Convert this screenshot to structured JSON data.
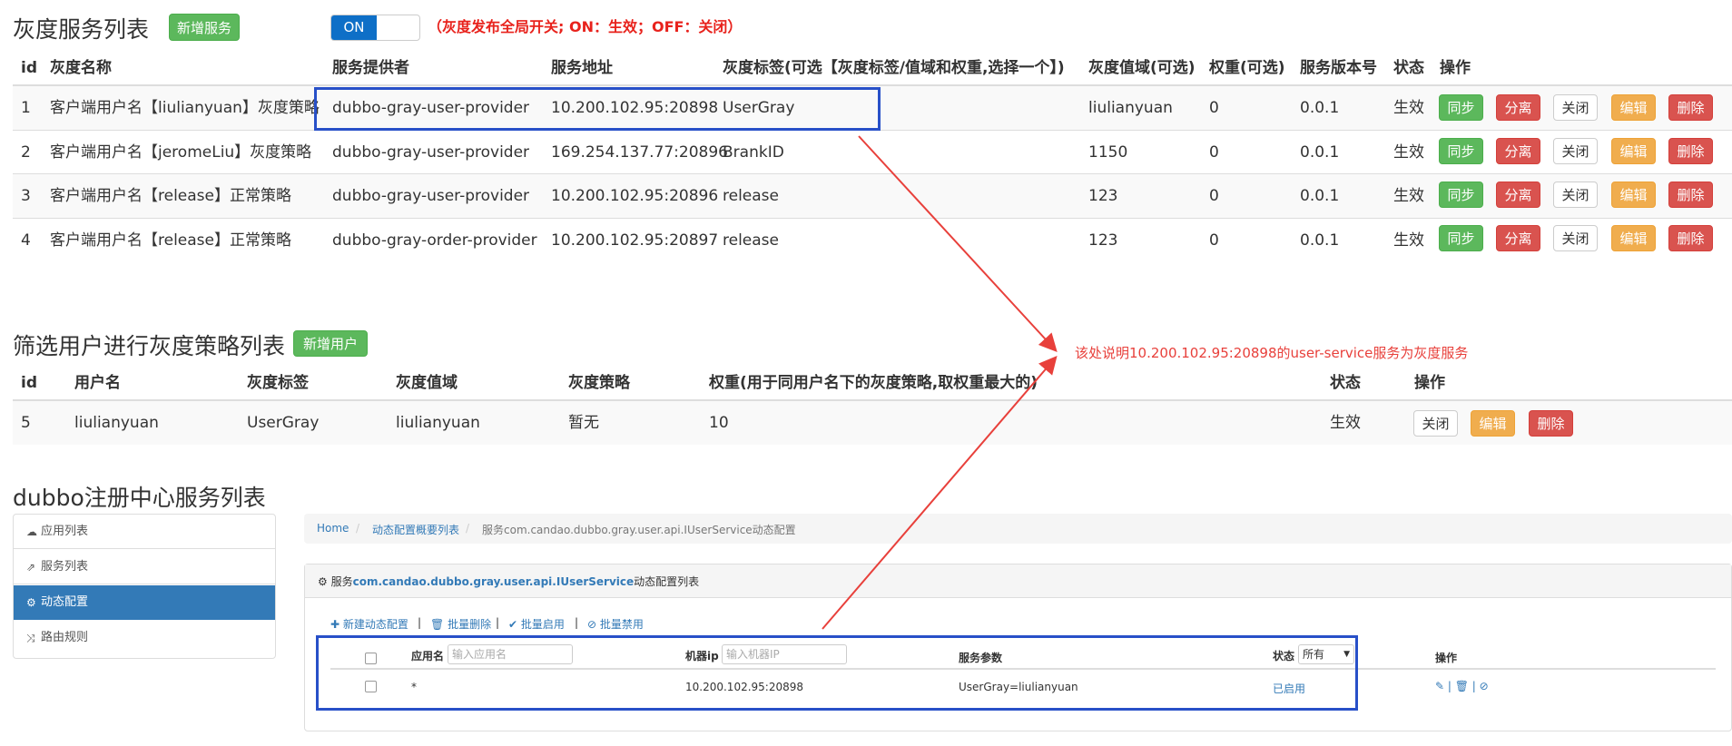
{
  "gray_section": {
    "title": "灰度服务列表",
    "add_button": "新增服务",
    "switch_on_label": "ON",
    "switch_note": "（灰度发布全局开关; ON：生效；OFF：关闭）",
    "columns": [
      "id",
      "灰度名称",
      "服务提供者",
      "服务地址",
      "灰度标签(可选【灰度标签/值域和权重,选择一个】)",
      "灰度值域(可选)",
      "权重(可选)",
      "服务版本号",
      "状态",
      "操作"
    ],
    "rows": [
      {
        "id": "1",
        "name": "客户端用户名【liuliany​uan】灰度策略",
        "provider": "dubbo-gray-user-provider",
        "address": "10.200.102.95:20898",
        "tag": "UserGray",
        "range": "liulianyuan",
        "weight": "0",
        "version": "0.0.1",
        "status": "生效"
      },
      {
        "id": "2",
        "name": "客户端用户名【jeromeLiu】灰度策略",
        "provider": "dubbo-gray-user-provider",
        "address": "169.254.137.77:20896",
        "tag": "BrankID",
        "range": "1150",
        "weight": "0",
        "version": "0.0.1",
        "status": "生效"
      },
      {
        "id": "3",
        "name": "客户端用户名【release】正常策略",
        "provider": "dubbo-gray-user-provider",
        "address": "10.200.102.95:20896",
        "tag": "release",
        "range": "123",
        "weight": "0",
        "version": "0.0.1",
        "status": "生效"
      },
      {
        "id": "4",
        "name": "客户端用户名【release】正常策略",
        "provider": "dubbo-gray-order-provider",
        "address": "10.200.102.95:20897",
        "tag": "release",
        "range": "123",
        "weight": "0",
        "version": "0.0.1",
        "status": "生效"
      }
    ],
    "actions": {
      "sync": "同步",
      "separate": "分离",
      "close": "关闭",
      "edit": "编辑",
      "delete": "删除"
    }
  },
  "user_section": {
    "title": "筛选用户进行灰度策略列表",
    "add_button": "新增用户",
    "columns": [
      "id",
      "用户名",
      "灰度标签",
      "灰度值域",
      "灰度策略",
      "权重(用于同用户名下的灰度策略,取权重最大的)",
      "状态",
      "操作"
    ],
    "rows": [
      {
        "id": "5",
        "username": "liulianyuan",
        "tag": "UserGray",
        "range": "liulianyuan",
        "strategy": "暂无",
        "weight": "10",
        "status": "生效"
      }
    ],
    "actions": {
      "close": "关闭",
      "edit": "编辑",
      "delete": "删除"
    }
  },
  "annotation": {
    "text": "该处说明10.200.102.95:20898的user-service服务为灰度服务",
    "color": "#e8403b"
  },
  "registry_section": {
    "title": "dubbo注册中心服务列表",
    "sidebar": [
      {
        "label": "应用列表",
        "icon": "cloud-icon"
      },
      {
        "label": "服务列表",
        "icon": "share-icon"
      },
      {
        "label": "动态配置",
        "icon": "cogs-icon"
      },
      {
        "label": "路由规则",
        "icon": "random-icon"
      }
    ],
    "breadcrumb": {
      "home": "Home",
      "overview": "动态配置概要列表",
      "current": "服务com.candao.dubbo.gray.user.api.IUserService动态配置"
    },
    "panel": {
      "title_prefix": "服务",
      "service_name": "com.candao.dubbo.gray.user.api.IUserService",
      "title_suffix": "动态配置列表"
    },
    "toolbar": {
      "new": "新建动态配置",
      "batch_delete": "批量删除",
      "batch_enable": "批量启用",
      "batch_disable": "批量禁用"
    },
    "table": {
      "col_app": "应用名",
      "app_placeholder": "输入应用名",
      "col_ip": "机器ip",
      "ip_placeholder": "输入机器IP",
      "col_params": "服务参数",
      "col_status": "状态",
      "status_select": "所有",
      "col_ops": "操作",
      "row": {
        "app": "*",
        "ip": "10.200.102.95:20898",
        "params": "UserGray=liulianyuan",
        "status": "已启用"
      }
    }
  },
  "colors": {
    "primary": "#337ab7",
    "success": "#5cb85c",
    "danger": "#d9534f",
    "warning": "#f0ad4e",
    "highlight_box": "#2850c8"
  }
}
